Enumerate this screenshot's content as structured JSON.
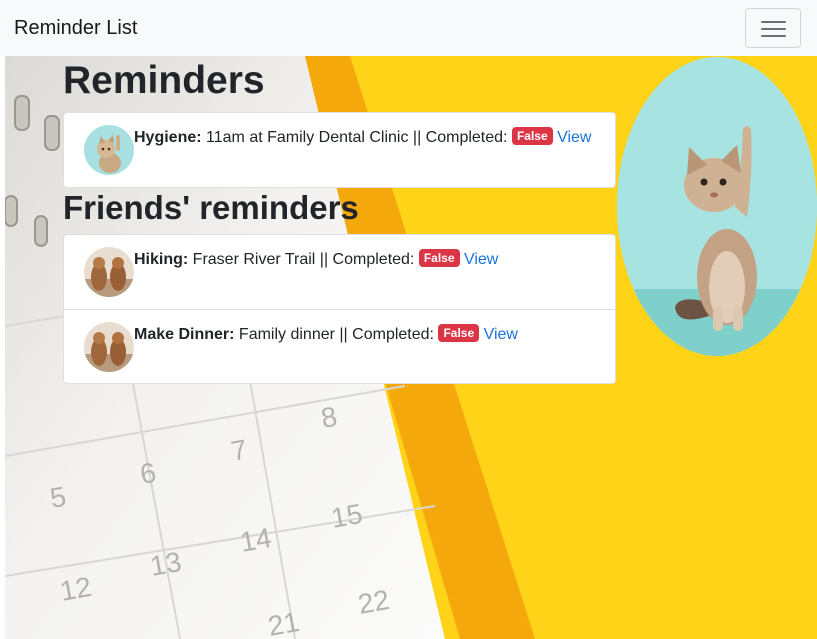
{
  "navbar": {
    "brand": "Reminder List",
    "toggle_icon": "hamburger-menu-icon"
  },
  "background": {
    "calendar_numbers": [
      "8",
      "7",
      "6",
      "5",
      "15",
      "14",
      "13",
      "12",
      "22",
      "21"
    ],
    "colors": {
      "yellow": "#ffd21a",
      "orange": "#f5a60a",
      "paper": "#f1f0ee"
    }
  },
  "reminders": {
    "heading": "Reminders",
    "items": [
      {
        "avatar": "cat-avatar",
        "title": "Hygiene:",
        "description": "11am at Family Dental Clinic || Completed:",
        "status": "False",
        "link": "View"
      }
    ]
  },
  "friends": {
    "heading": "Friends' reminders",
    "items": [
      {
        "avatar": "dogs-avatar",
        "title": "Hiking:",
        "description": "Fraser River Trail || Completed:",
        "status": "False",
        "link": "View"
      },
      {
        "avatar": "dogs-avatar",
        "title": "Make Dinner:",
        "description": "Family dinner || Completed:",
        "status": "False",
        "link": "View"
      }
    ]
  },
  "side_image": {
    "subject": "kitten-photo"
  },
  "theme": {
    "badge_danger": "#dc3545",
    "link": "#1a73d9",
    "navbar_bg": "#f8f9fa"
  }
}
